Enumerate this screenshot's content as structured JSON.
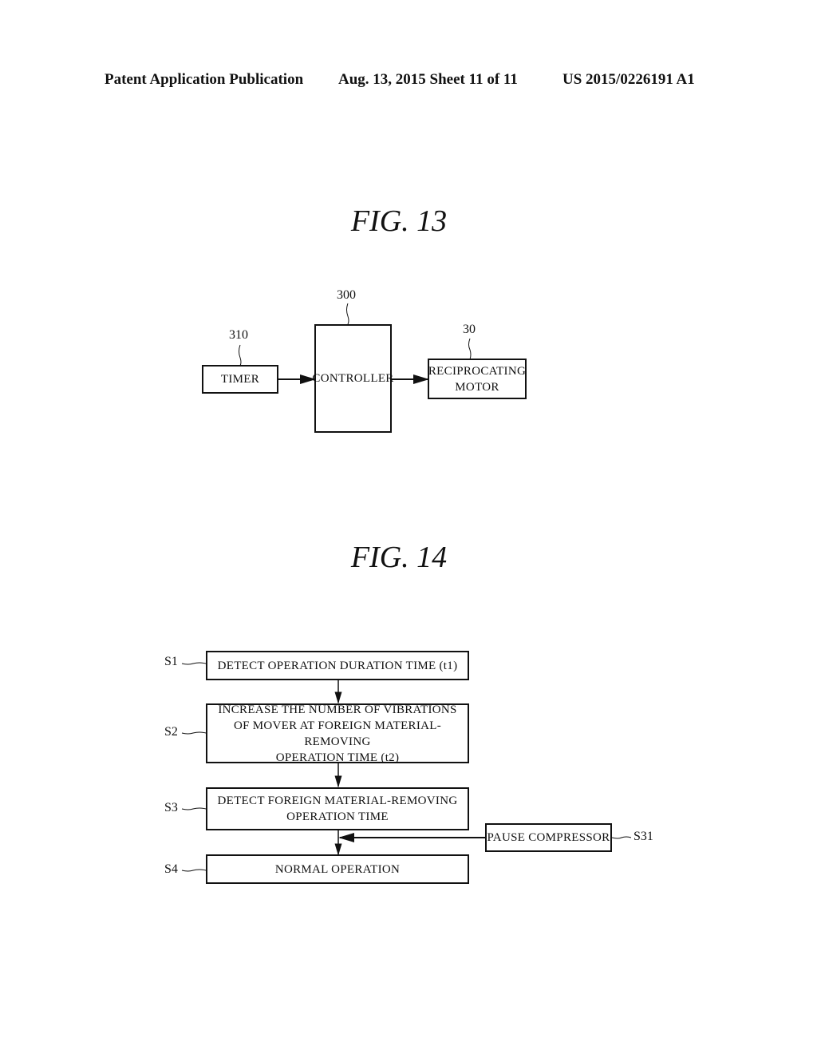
{
  "header": {
    "publication": "Patent Application Publication",
    "date_sheet": "Aug. 13, 2015  Sheet 11 of 11",
    "number": "US 2015/0226191 A1"
  },
  "fig13": {
    "title": "FIG. 13",
    "blocks": [
      {
        "ref": "310",
        "label": "TIMER"
      },
      {
        "ref": "300",
        "label": "CONTROLLER"
      },
      {
        "ref": "30",
        "label": "RECIPROCATING\nMOTOR"
      }
    ]
  },
  "fig14": {
    "title": "FIG. 14",
    "steps": [
      {
        "ref": "S1",
        "label": "DETECT OPERATION DURATION TIME (t1)"
      },
      {
        "ref": "S2",
        "label": "INCREASE THE NUMBER OF VIBRATIONS\nOF MOVER AT FOREIGN MATERIAL-REMOVING\nOPERATION TIME (t2)"
      },
      {
        "ref": "S3",
        "label": "DETECT FOREIGN MATERIAL-REMOVING\nOPERATION TIME"
      },
      {
        "ref": "S4",
        "label": "NORMAL OPERATION"
      },
      {
        "ref": "S31",
        "label": "PAUSE COMPRESSOR"
      }
    ]
  }
}
